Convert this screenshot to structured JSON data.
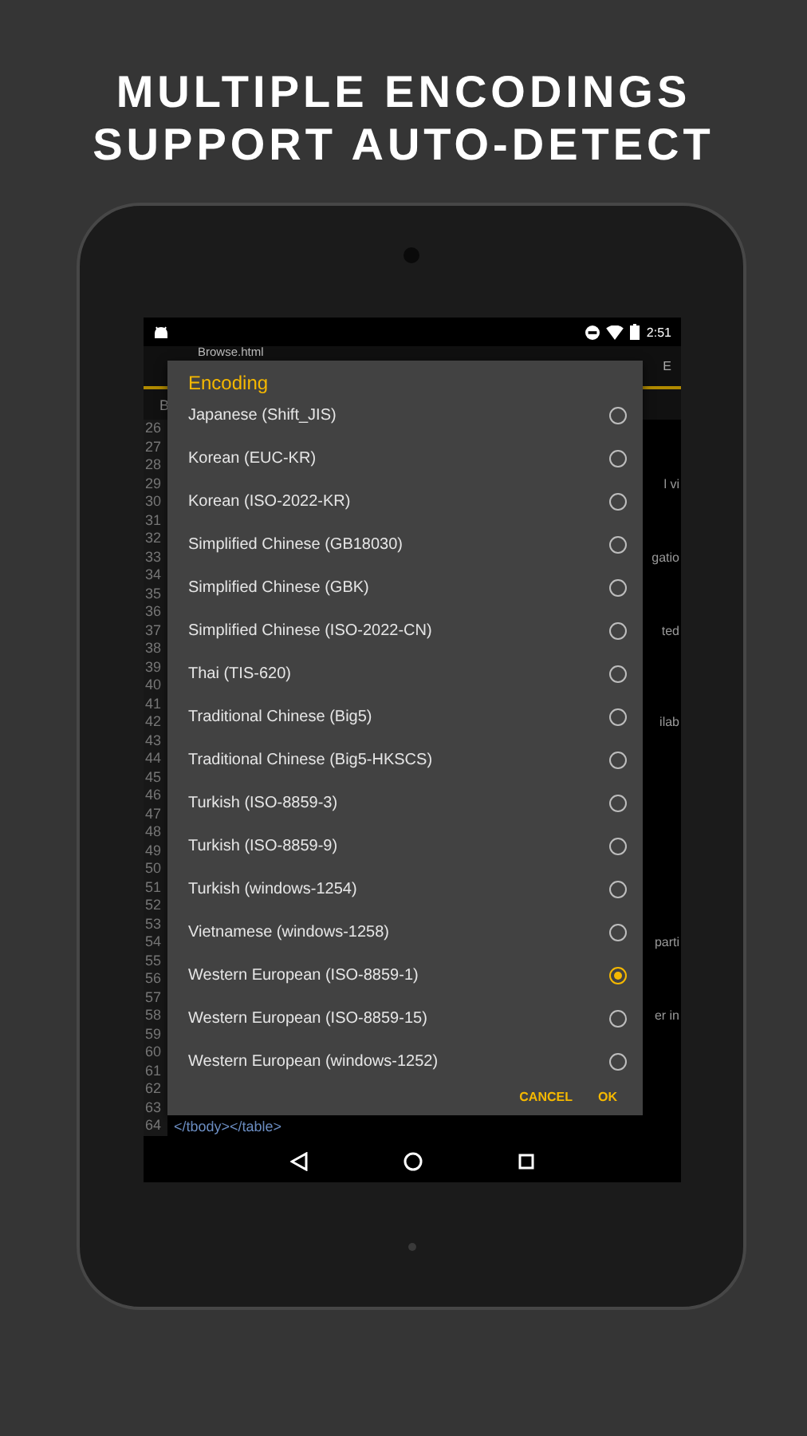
{
  "headline": [
    "MULTIPLE ENCODINGS",
    "SUPPORT AUTO-DETECT"
  ],
  "status_bar": {
    "time": "2:51"
  },
  "toolbar": {
    "title": "Browse.html",
    "action_fragment": "E"
  },
  "tab_strip": {
    "label_fragment": "B"
  },
  "editor": {
    "lines": [
      {
        "number": "26"
      },
      {
        "number": "27"
      },
      {
        "number": "28"
      },
      {
        "number": "29",
        "tail": "l vi"
      },
      {
        "number": "30"
      },
      {
        "number": "31"
      },
      {
        "number": "32"
      },
      {
        "number": "33",
        "tail": "gatio"
      },
      {
        "number": "34"
      },
      {
        "number": "35"
      },
      {
        "number": "36"
      },
      {
        "number": "37",
        "tail": "ted"
      },
      {
        "number": "38"
      },
      {
        "number": "39"
      },
      {
        "number": "40"
      },
      {
        "number": "41"
      },
      {
        "number": "42",
        "tail": "ilab"
      },
      {
        "number": "43"
      },
      {
        "number": "44"
      },
      {
        "number": "45"
      },
      {
        "number": "46"
      },
      {
        "number": "47"
      },
      {
        "number": "48"
      },
      {
        "number": "49"
      },
      {
        "number": "50"
      },
      {
        "number": "51"
      },
      {
        "number": "52"
      },
      {
        "number": "53"
      },
      {
        "number": "54",
        "tail": "parti"
      },
      {
        "number": "55"
      },
      {
        "number": "56"
      },
      {
        "number": "57"
      },
      {
        "number": "58",
        "tail": "er in"
      },
      {
        "number": "59"
      },
      {
        "number": "60"
      },
      {
        "number": "61"
      },
      {
        "number": "62"
      },
      {
        "number": "63"
      },
      {
        "number": "64",
        "code": "</tbody></table>"
      }
    ]
  },
  "dialog": {
    "title": "Encoding",
    "options": [
      {
        "label": "Japanese (Shift_JIS)",
        "selected": false
      },
      {
        "label": "Korean (EUC-KR)",
        "selected": false
      },
      {
        "label": "Korean (ISO-2022-KR)",
        "selected": false
      },
      {
        "label": "Simplified Chinese (GB18030)",
        "selected": false
      },
      {
        "label": "Simplified Chinese (GBK)",
        "selected": false
      },
      {
        "label": "Simplified Chinese (ISO-2022-CN)",
        "selected": false
      },
      {
        "label": "Thai (TIS-620)",
        "selected": false
      },
      {
        "label": "Traditional Chinese (Big5)",
        "selected": false
      },
      {
        "label": "Traditional Chinese (Big5-HKSCS)",
        "selected": false
      },
      {
        "label": "Turkish (ISO-8859-3)",
        "selected": false
      },
      {
        "label": "Turkish (ISO-8859-9)",
        "selected": false
      },
      {
        "label": "Turkish (windows-1254)",
        "selected": false
      },
      {
        "label": "Vietnamese (windows-1258)",
        "selected": false
      },
      {
        "label": "Western European (ISO-8859-1)",
        "selected": true
      },
      {
        "label": "Western European (ISO-8859-15)",
        "selected": false
      },
      {
        "label": "Western European (windows-1252)",
        "selected": false
      }
    ],
    "buttons": [
      "CANCEL",
      "OK"
    ]
  }
}
